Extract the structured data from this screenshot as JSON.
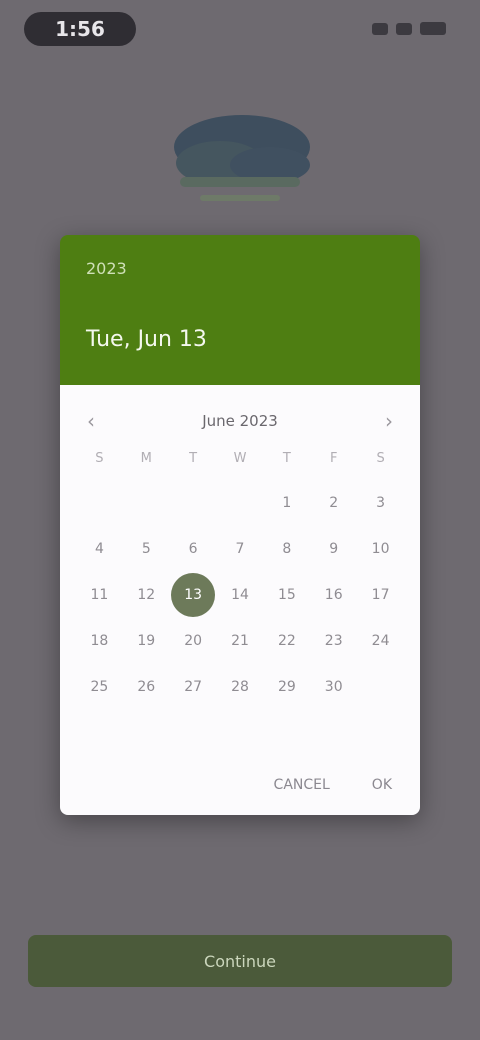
{
  "status_bar": {
    "time": "1:56"
  },
  "colors": {
    "header_green": "#4e7e12",
    "selected_day": "#6d7a5a",
    "scrim": "#6e6a70"
  },
  "date_picker": {
    "year": "2023",
    "selected_date": "Tue, Jun 13",
    "month_label": "June 2023",
    "weekdays": [
      "S",
      "M",
      "T",
      "W",
      "T",
      "F",
      "S"
    ],
    "leading_blanks": 4,
    "days": [
      "1",
      "2",
      "3",
      "4",
      "5",
      "6",
      "7",
      "8",
      "9",
      "10",
      "11",
      "12",
      "13",
      "14",
      "15",
      "16",
      "17",
      "18",
      "19",
      "20",
      "21",
      "22",
      "23",
      "24",
      "25",
      "26",
      "27",
      "28",
      "29",
      "30"
    ],
    "selected_day": "13",
    "cancel_label": "CANCEL",
    "ok_label": "OK"
  },
  "bottom_button": {
    "label": "Continue"
  }
}
